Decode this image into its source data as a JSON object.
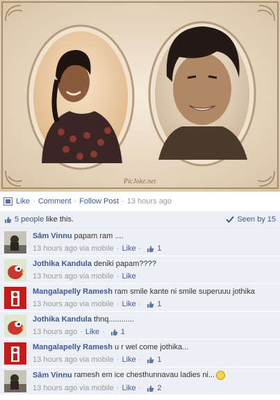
{
  "photo": {
    "watermark": "PicJoke.net"
  },
  "actions": {
    "like": "Like",
    "comment": "Comment",
    "follow": "Follow Post",
    "time": "13 hours ago",
    "separator": "·"
  },
  "likes": {
    "people": "5 people",
    "suffix": " like this.",
    "seen": "Seen by 15"
  },
  "comments": [
    {
      "author": "Sâm Vinnu",
      "text": "papam ram ....",
      "time": "13 hours ago via mobile",
      "like": "Like",
      "count": "1"
    },
    {
      "author": "Jothika Kandula",
      "text": "deniki papam????",
      "time": "13 hours ago via mobile",
      "like": "Like",
      "count": ""
    },
    {
      "author": "Mangalapelly Ramesh",
      "text": "ram smile kante ni smile superuuu jothika",
      "time": "13 hours ago via mobile",
      "like": "Like",
      "count": "1"
    },
    {
      "author": "Jothika Kandula",
      "text": "thnq............",
      "time": "13 hours ago",
      "like": "Like",
      "count": "1"
    },
    {
      "author": "Mangalapelly Ramesh",
      "text": "u r wel come jothika...",
      "time": "13 hours ago via mobile",
      "like": "Like",
      "count": "1"
    },
    {
      "author": "Sâm Vinnu",
      "text": "ramesh em ice chesthunnavau ladies ni...",
      "time": "13 hours ago via mobile",
      "like": "Like",
      "count": "2"
    }
  ],
  "colors": {
    "link": "#3b5998",
    "panel": "#edeff4",
    "meta": "#999999"
  }
}
